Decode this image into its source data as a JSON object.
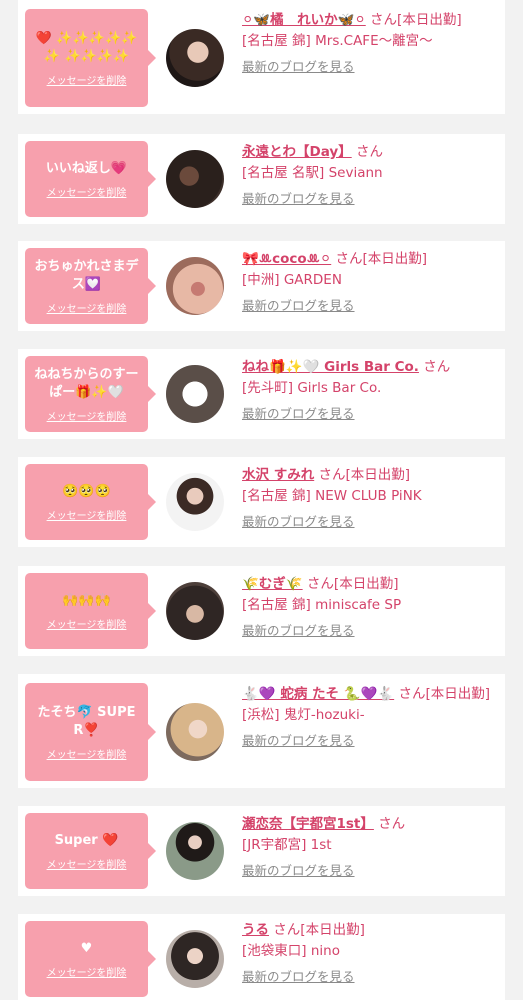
{
  "delete_label": "メッセージを削除",
  "blog_label": "最新のブログを見る",
  "items": [
    {
      "message": "❤️ ✨✨✨✨✨✨ ✨✨✨✨",
      "name": "⚪︎🦋橘　れいか🦋⚪︎",
      "suffix": "さん[本日出勤]",
      "shop": "[名古屋 錦] Mrs.CAFE〜離宮〜"
    },
    {
      "message": "いいね返し💗",
      "name": "永遠とわ【Day】",
      "suffix": "さん",
      "shop": "[名古屋 名駅] Seviann"
    },
    {
      "message": "おちゅかれさまデス💟",
      "name": "🎀ꔛcocoꔛ⚪︎",
      "suffix": "さん[本日出勤]",
      "shop": "[中洲] GARDEN"
    },
    {
      "message": "ねねちからのすーぱー🎁✨🤍",
      "name": "ねね🎁✨🤍 Girls Bar Co.",
      "suffix": "さん",
      "shop": "[先斗町] Girls Bar Co."
    },
    {
      "message": "🥺🥺🥺",
      "name": "水沢 すみれ",
      "suffix": "さん[本日出勤]",
      "shop": "[名古屋 錦] NEW CLUB PiNK"
    },
    {
      "message": "🙌🙌🙌",
      "name": "🌾むぎ🌾",
      "suffix": "さん[本日出勤]",
      "shop": "[名古屋 錦] miniscafe SP"
    },
    {
      "message": "たそち🐬 SUPER❣️",
      "name": "🐇💜 蛇病 たそ 🐍💜🐇",
      "suffix": "さん[本日出勤]",
      "shop": "[浜松] 鬼灯-hozuki-"
    },
    {
      "message": "Super ❤️",
      "name": "瀬恋奈【宇都宮1st】",
      "suffix": "さん",
      "shop": "[JR宇都宮] 1st"
    },
    {
      "message": "♥",
      "name": "うる",
      "suffix": "さん[本日出勤]",
      "shop": "[池袋東口] nino"
    }
  ],
  "colors": {
    "accent": "#f7a0ad",
    "name": "#d4436a",
    "background": "#f2f2f2"
  }
}
